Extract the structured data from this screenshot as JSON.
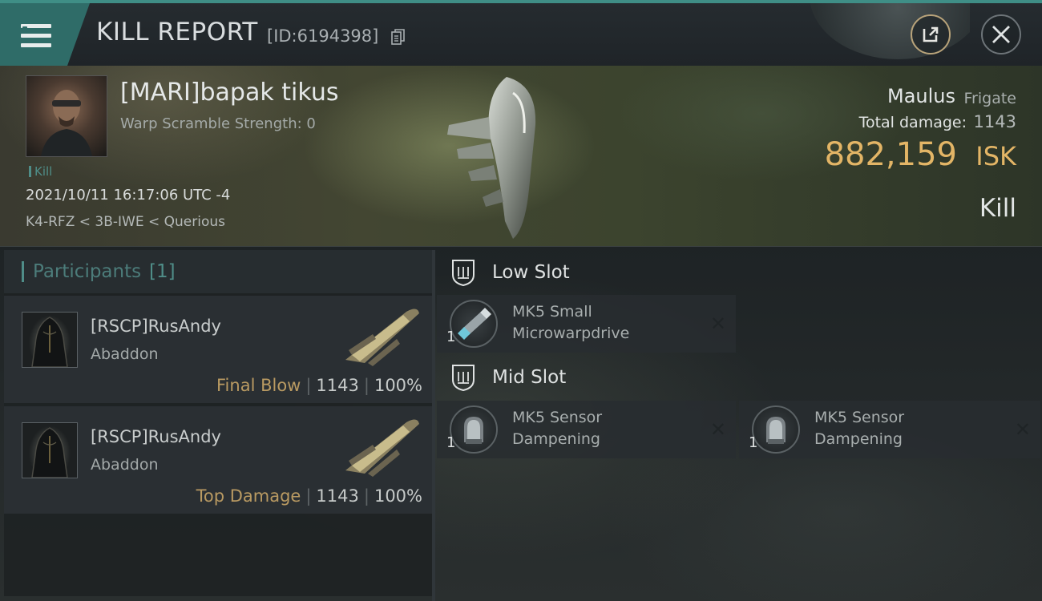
{
  "header": {
    "title": "KILL REPORT",
    "report_id": "[ID:6194398]"
  },
  "victim": {
    "name": "[MARI]bapak tikus",
    "warp_scramble": "Warp Scramble Strength: 0",
    "tag": "Kill",
    "timestamp": "2021/10/11 16:17:06 UTC -4",
    "location": "K4-RFZ < 3B-IWE < Querious",
    "ship_name": "Maulus",
    "ship_class": "Frigate",
    "total_damage_label": "Total damage:",
    "total_damage": "1143",
    "isk_value": "882,159",
    "isk_label": "ISK",
    "result": "Kill"
  },
  "participants": {
    "title": "Participants",
    "count": "[1]",
    "items": [
      {
        "name": "[RSCP]RusAndy",
        "ship": "Abaddon",
        "role": "Final Blow",
        "damage": "1143",
        "percent": "100%"
      },
      {
        "name": "[RSCP]RusAndy",
        "ship": "Abaddon",
        "role": "Top Damage",
        "damage": "1143",
        "percent": "100%"
      }
    ]
  },
  "fitting": {
    "low_slot": {
      "title": "Low Slot",
      "modules": [
        {
          "name_line1": "MK5 Small",
          "name_line2": "Microwarpdrive",
          "qty": "1"
        }
      ]
    },
    "mid_slot": {
      "title": "Mid Slot",
      "modules": [
        {
          "name_line1": "MK5 Sensor",
          "name_line2": "Dampening",
          "qty": "1"
        },
        {
          "name_line1": "MK5 Sensor",
          "name_line2": "Dampening",
          "qty": "1"
        }
      ]
    }
  },
  "colors": {
    "accent_teal": "#4f8d88",
    "isk_gold": "#e3b566",
    "role_gold": "#b99a62"
  }
}
